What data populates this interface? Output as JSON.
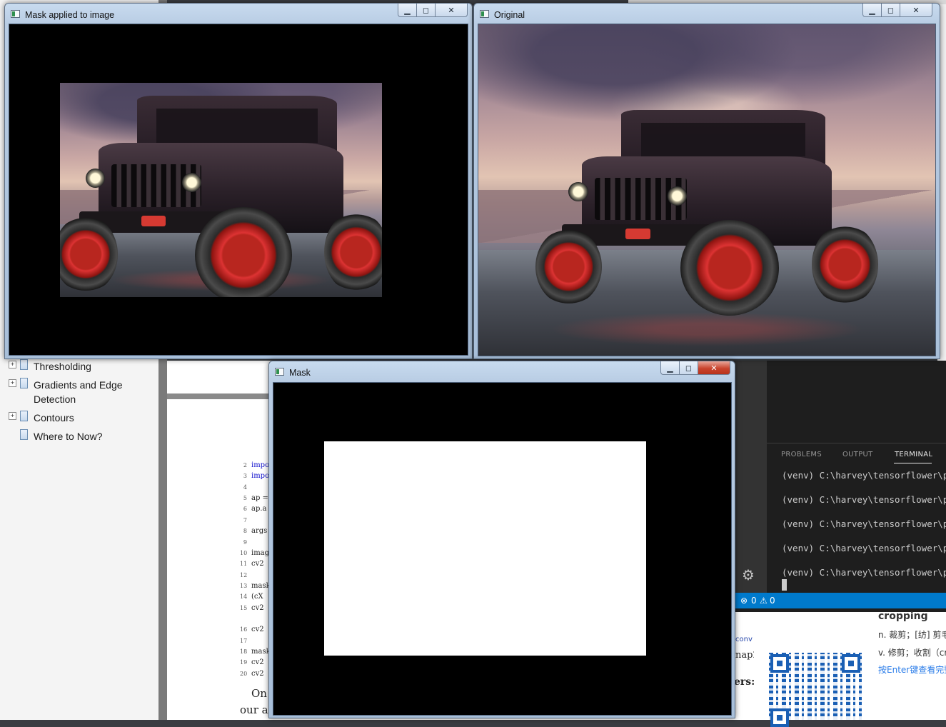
{
  "sidebar": {
    "items": [
      {
        "label": "Thresholding",
        "expandable": true
      },
      {
        "label": "Gradients and Edge",
        "label2": "Detection",
        "expandable": true
      },
      {
        "label": "Contours",
        "expandable": true
      },
      {
        "label": "Where to Now?",
        "expandable": false
      }
    ]
  },
  "pdf": {
    "code_lines": [
      {
        "n": "2",
        "text": "impo",
        "kw": true
      },
      {
        "n": "3",
        "text": "impo",
        "kw": true
      },
      {
        "n": "4",
        "text": ""
      },
      {
        "n": "5",
        "text": "ap ="
      },
      {
        "n": "6",
        "text": "ap.a"
      },
      {
        "n": "7",
        "text": ""
      },
      {
        "n": "8",
        "text": "args"
      },
      {
        "n": "9",
        "text": ""
      },
      {
        "n": "10",
        "text": "imag"
      },
      {
        "n": "11",
        "text": "cv2"
      },
      {
        "n": "12",
        "text": ""
      },
      {
        "n": "13",
        "text": "mask"
      },
      {
        "n": "14",
        "text": "(cX"
      },
      {
        "n": "15",
        "text": "cv2"
      },
      {
        "n": "16",
        "text": "cv2"
      },
      {
        "n": "17",
        "text": ""
      },
      {
        "n": "18",
        "text": "mask"
      },
      {
        "n": "19",
        "text": "cv2"
      },
      {
        "n": "20",
        "text": "cv2"
      }
    ],
    "prose_1": "On",
    "prose_2": "our a",
    "right_snip_1": "conv",
    "right_snip_2": "nap2",
    "right_snip_3": "ers:"
  },
  "vscode": {
    "panel_tabs": [
      "PROBLEMS",
      "OUTPUT",
      "TERMINAL"
    ],
    "active_tab": "TERMINAL",
    "terminal_lines": [
      "(venv) C:\\harvey\\tensorflower\\pra",
      "(venv) C:\\harvey\\tensorflower\\pra",
      "(venv) C:\\harvey\\tensorflower\\pra",
      "(venv) C:\\harvey\\tensorflower\\pra",
      "(venv) C:\\harvey\\tensorflower\\pra"
    ],
    "status": {
      "errors": "0",
      "warnings": "0"
    }
  },
  "dictionary": {
    "word": "cropping",
    "noun": "n. 裁剪；[纺] 剪毛",
    "verb": "v. 修剪；收割（cr",
    "hint": "按Enter键查看完整"
  },
  "windows": {
    "mask_applied": {
      "title": "Mask applied to image"
    },
    "original": {
      "title": "Original"
    },
    "mask": {
      "title": "Mask"
    }
  },
  "colors": {
    "mask_background": "#000000",
    "mask_rect": "#ffffff",
    "vscode_statusbar": "#007acc",
    "close_button_red": "#c9442d"
  }
}
